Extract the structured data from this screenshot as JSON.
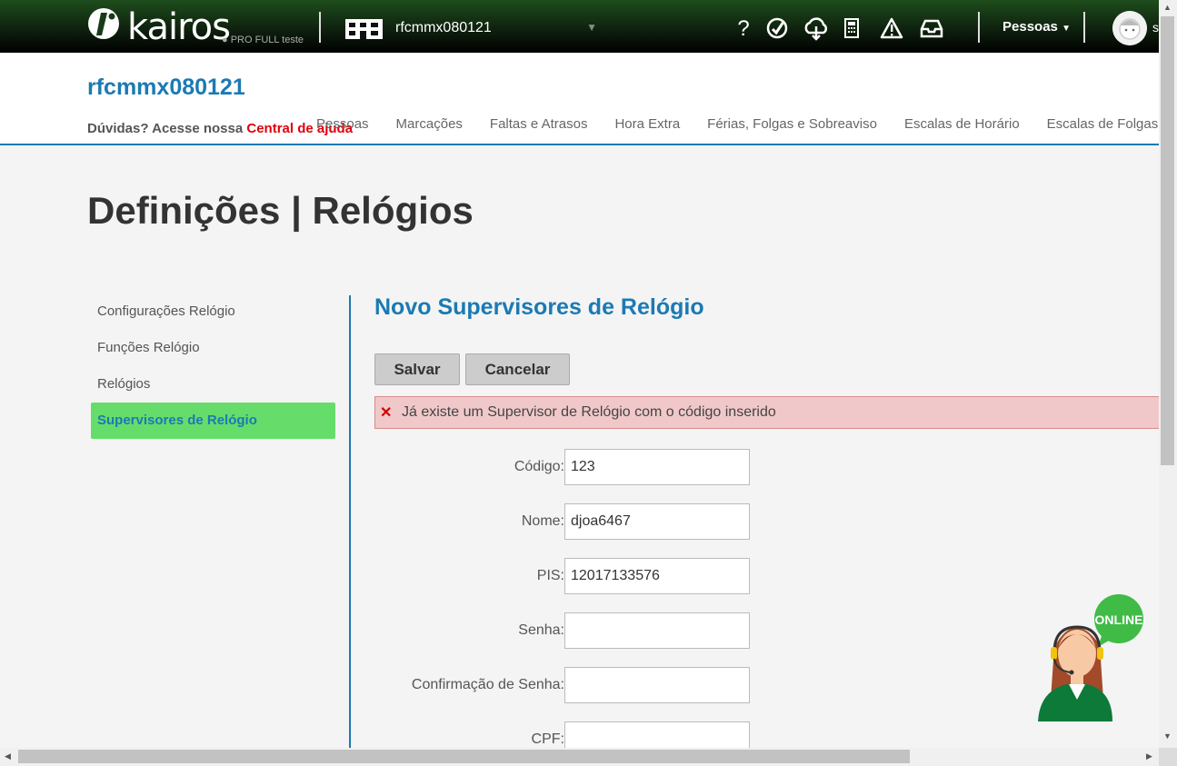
{
  "topbar": {
    "logo_text": "kairos",
    "logo_subtitle": "PRO FULL teste",
    "company_name": "rfcmmx080121",
    "icons": [
      "help-icon",
      "support-icon",
      "cloud-sync-icon",
      "calculator-icon",
      "warning-icon",
      "inbox-icon"
    ],
    "pessoas_menu": "Pessoas",
    "user_initial": "s"
  },
  "header": {
    "title": "rfcmmx080121",
    "help_prefix": "Dúvidas? Acesse nossa ",
    "help_link": "Central de ajuda",
    "nav": [
      "Pessoas",
      "Marcações",
      "Faltas e Atrasos",
      "Hora Extra",
      "Férias, Folgas e Sobreaviso",
      "Escalas de Horário",
      "Escalas de Folgas"
    ]
  },
  "page": {
    "title": "Definições | Relógios"
  },
  "sidebar": {
    "items": [
      {
        "label": "Configurações Relógio",
        "active": false
      },
      {
        "label": "Funções Relógio",
        "active": false
      },
      {
        "label": "Relógios",
        "active": false
      },
      {
        "label": "Supervisores de Relógio",
        "active": true
      }
    ]
  },
  "content": {
    "title": "Novo Supervisores de Relógio",
    "save_label": "Salvar",
    "cancel_label": "Cancelar",
    "alert": "Já existe um Supervisor de Relógio com o código inserido",
    "fields": [
      {
        "label": "Código:",
        "value": "123"
      },
      {
        "label": "Nome:",
        "value": "djoa6467"
      },
      {
        "label": "PIS:",
        "value": "12017133576"
      },
      {
        "label": "Senha:",
        "value": ""
      },
      {
        "label": "Confirmação de Senha:",
        "value": ""
      },
      {
        "label": "CPF:",
        "value": ""
      }
    ]
  },
  "chat": {
    "badge": "ONLINE"
  },
  "colors": {
    "brand_blue": "#1b7ab3",
    "active_green": "#66dd6a",
    "alert_bg": "#f1c8c9",
    "help_red": "#e0000c"
  }
}
